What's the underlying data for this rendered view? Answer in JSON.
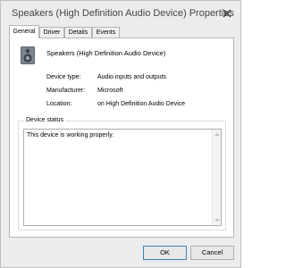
{
  "window": {
    "title": "Speakers (High Definition Audio Device) Properties"
  },
  "tabs": [
    {
      "label": "General",
      "active": true
    },
    {
      "label": "Driver",
      "active": false
    },
    {
      "label": "Details",
      "active": false
    },
    {
      "label": "Events",
      "active": false
    }
  ],
  "device": {
    "icon": "speaker-icon",
    "name": "Speakers (High Definition Audio Device)"
  },
  "properties": [
    {
      "label": "Device type:",
      "value": "Audio inputs and outputs"
    },
    {
      "label": "Manufacturer:",
      "value": "Microsoft"
    },
    {
      "label": "Location:",
      "value": "on High Definition Audio Device"
    }
  ],
  "status": {
    "legend": "Device status",
    "text": "This device is working properly."
  },
  "buttons": {
    "ok": "OK",
    "cancel": "Cancel"
  }
}
